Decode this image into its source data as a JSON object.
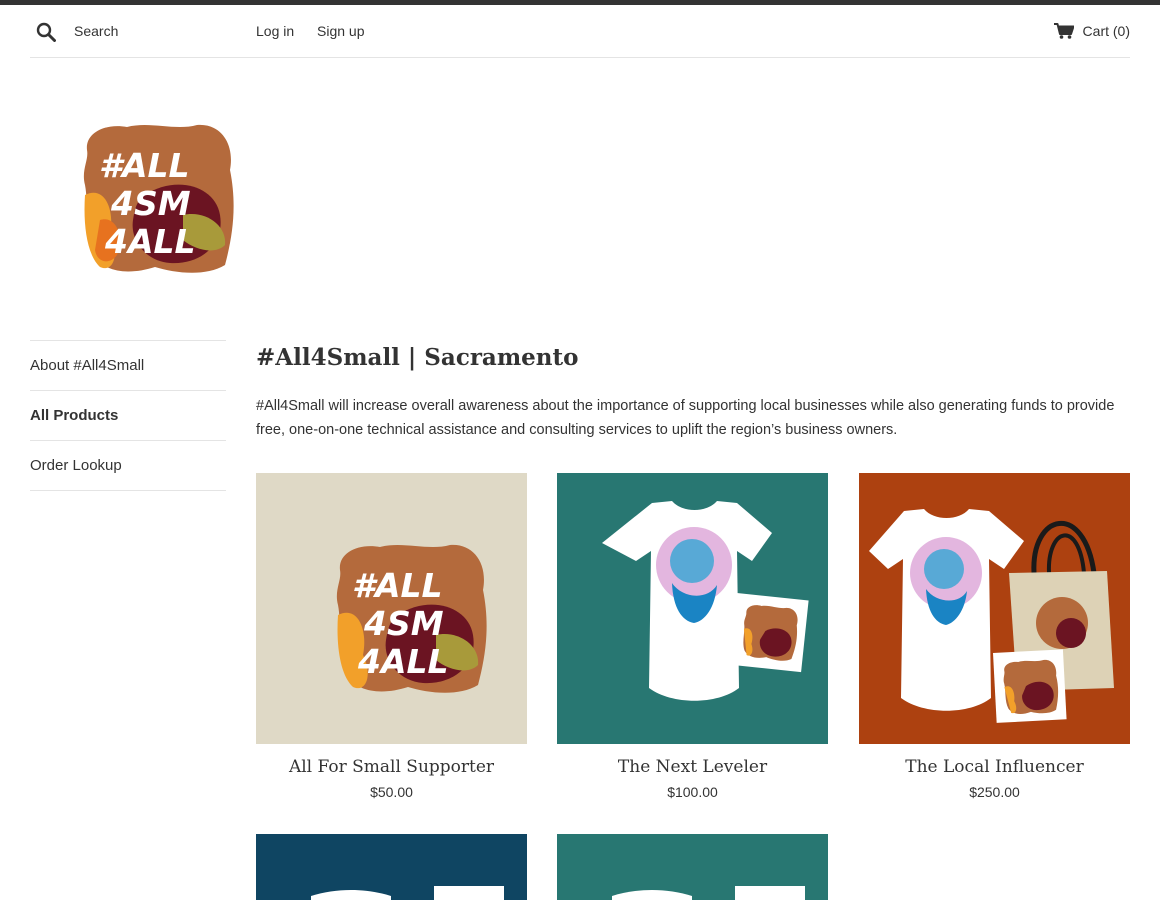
{
  "header": {
    "search_button": "Search",
    "search_placeholder": "Search",
    "login": "Log in",
    "signup": "Sign up",
    "cart_label": "Cart (0)"
  },
  "sidebar": {
    "items": [
      {
        "label": "About #All4Small",
        "active": false
      },
      {
        "label": "All Products",
        "active": true
      },
      {
        "label": "Order Lookup",
        "active": false
      }
    ]
  },
  "main": {
    "title": "#All4Small | Sacramento",
    "description": "#All4Small will increase overall awareness about the importance of supporting local businesses while also generating funds to provide free, one-on-one technical assistance and consulting services to uplift the region’s business owners.",
    "products": [
      {
        "name": "All For Small Supporter",
        "price": "$50.00",
        "bg": "#dfd9c6"
      },
      {
        "name": "The Next Leveler",
        "price": "$100.00",
        "bg": "#287772"
      },
      {
        "name": "The Local Influencer",
        "price": "$250.00",
        "bg": "#ad4110"
      },
      {
        "name": "",
        "price": "",
        "bg": "#0f4562"
      },
      {
        "name": "",
        "price": "",
        "bg": "#287772"
      }
    ]
  },
  "logo_text": [
    "#ALL",
    "4SM",
    "4ALL"
  ]
}
